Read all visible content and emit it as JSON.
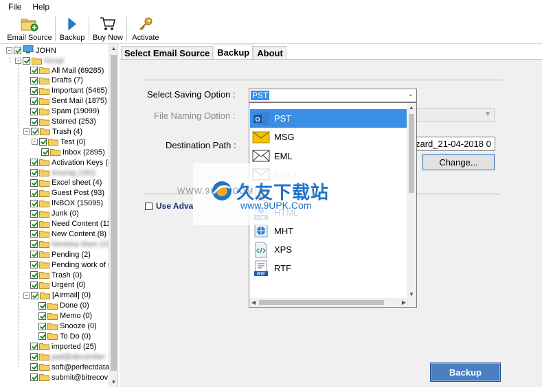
{
  "menu": {
    "file": "File",
    "help": "Help"
  },
  "toolbar": {
    "email_source": "Email Source",
    "backup": "Backup",
    "buy_now": "Buy Now",
    "activate": "Activate"
  },
  "tree": {
    "root": "JOHN",
    "account": "Gmail",
    "items": [
      "All Mail (69285)",
      "Drafts (7)",
      "Important (5465)",
      "Sent Mail (1875)",
      "Spam (19099)",
      "Starred (253)",
      "Trash (4)",
      "Test (0)",
      "Inbox (2895)",
      "Activation Keys (3",
      "Anurag (182)",
      "Excel sheet (4)",
      "Guest Post (93)",
      "INBOX (15095)",
      "Junk (0)",
      "Need Content (11",
      "New Content (8)",
      "Nimisha Mam (15",
      "Pending (2)",
      "Pending work of s",
      "Trash (0)",
      "Urgent (0)",
      "[Airmail] (0)",
      "Done (0)",
      "Memo (0)",
      "Snooze (0)",
      "To Do (0)",
      "imported (25)",
      "pad@abcamber",
      "soft@perfectdata",
      "submit@bitrecov"
    ]
  },
  "tabs": {
    "select_email_source": "Select Email Source",
    "backup": "Backup",
    "about": "About"
  },
  "form": {
    "saving_label": "Select Saving Option :",
    "saving_value": "PST",
    "naming_label": "File Naming Option :",
    "dest_label": "Destination Path :",
    "dest_value": "zard_21-04-2018 0",
    "change_label": "Change...",
    "use_advance": "Use Adva",
    "backup_label": "Backup"
  },
  "dropdown": {
    "options": [
      "PST",
      "MSG",
      "EML",
      "EMLX",
      "",
      "HTML",
      "MHT",
      "XPS",
      "RTF"
    ],
    "selected": "PST"
  },
  "watermark": {
    "site": "WWW.9UPK.COM",
    "cn": "久友下载站",
    "url": "www.9UPK.Com"
  },
  "colors": {
    "accent": "#3a8ee6",
    "backup_button": "#4a7fc0",
    "tree_check": "#1a8f1a"
  }
}
